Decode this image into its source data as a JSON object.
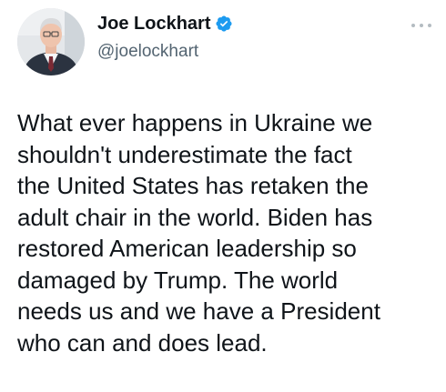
{
  "author": {
    "display_name": "Joe Lockhart",
    "handle": "@joelockhart",
    "verified": true,
    "avatar_icon": "profile-photo",
    "verified_icon": "verified-badge-icon"
  },
  "menu": {
    "icon": "more-options-icon"
  },
  "tweet": {
    "text": "What ever happens in Ukraine we\nshouldn't underestimate the fact\nthe United States has retaken the\nadult chair in the world. Biden has\nrestored American leadership so\ndamaged by Trump. The world\nneeds us and we have a President\nwho can and does lead."
  },
  "colors": {
    "text": "#0f1419",
    "secondary_text": "#536471",
    "verified_blue": "#1d9bf0",
    "background": "#ffffff"
  }
}
